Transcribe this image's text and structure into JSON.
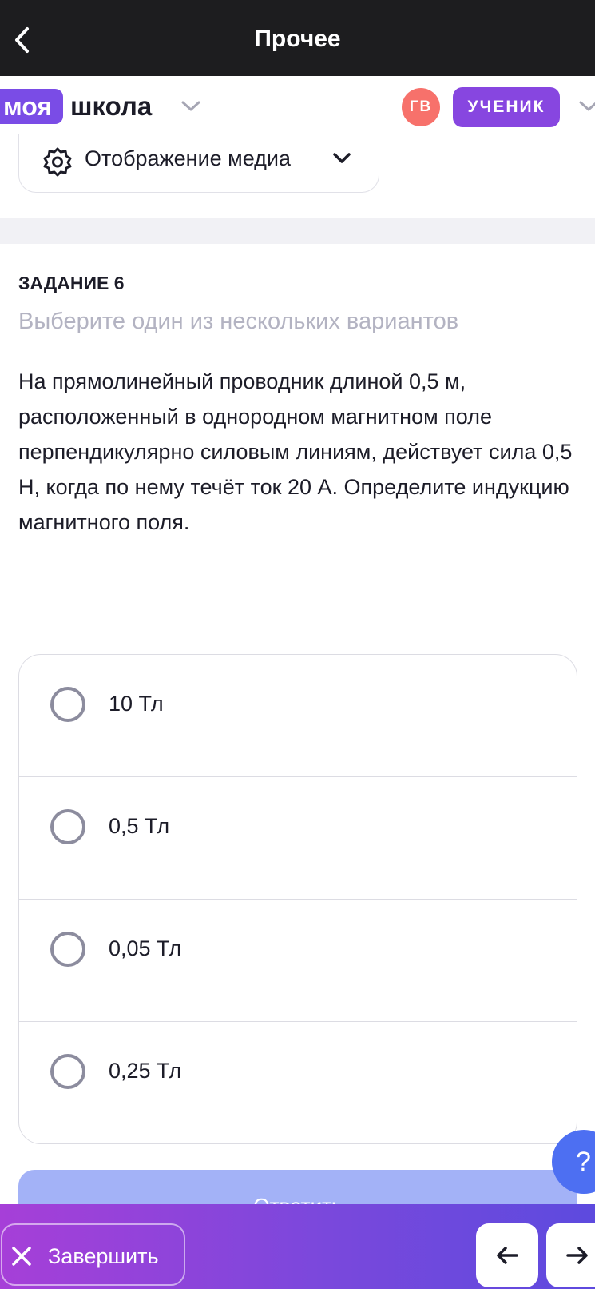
{
  "topbar": {
    "title": "Прочее"
  },
  "header": {
    "logo_part1": "моя",
    "logo_part2": "школа",
    "avatar_initials": "ГВ",
    "role": "УЧЕНИК"
  },
  "media": {
    "label": "Отображение медиа"
  },
  "task": {
    "number_label": "ЗАДАНИЕ 6",
    "hint": "Выберите один из нескольких вариантов",
    "question": "На прямолинейный проводник длиной 0,5 м, расположенный в однородном магнитном поле перпендикулярно силовым линиям, действует сила 0,5 Н, когда по нему течёт ток 20 А. Определите индукцию магнитного поля."
  },
  "options": [
    {
      "label": "10 Тл",
      "selected": false
    },
    {
      "label": "0,5 Тл",
      "selected": false
    },
    {
      "label": "0,05 Тл",
      "selected": false
    },
    {
      "label": "0,25 Тл",
      "selected": false
    }
  ],
  "answer_button": {
    "label": "Ответить"
  },
  "help_button": {
    "label": "?"
  },
  "footer": {
    "finish_label": "Завершить"
  },
  "colors": {
    "accent_purple": "#8746e0",
    "avatar_red": "#f7716b",
    "answer_disabled": "#a3b2f7",
    "help_blue": "#4d6ff2",
    "bottom_gradient": [
      "#a63fd8",
      "#5d4ade"
    ]
  },
  "icons": [
    "back-arrow-icon",
    "chevron-down-icon",
    "gear-icon",
    "close-icon",
    "arrow-left-icon",
    "arrow-right-icon"
  ]
}
